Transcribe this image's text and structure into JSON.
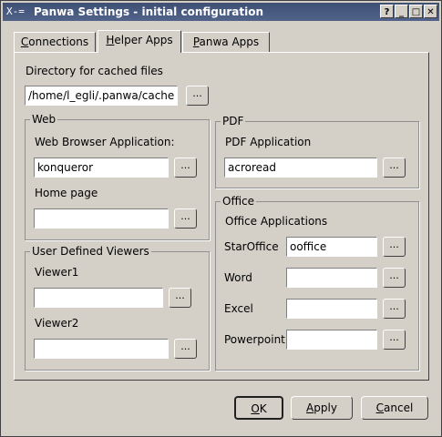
{
  "titlebar": {
    "icon": "X-=",
    "title": "Panwa Settings - initial configuration",
    "buttons": [
      "?",
      "_",
      "□",
      "✕"
    ]
  },
  "tabs": [
    {
      "label": "Connections",
      "accel": "C",
      "rest": "onnections",
      "active": false
    },
    {
      "label": "Helper Apps",
      "accel": "H",
      "rest": "elper Apps",
      "active": true
    },
    {
      "label": "Panwa Apps",
      "accel": "P",
      "rest": "anwa Apps",
      "active": false
    }
  ],
  "cache": {
    "label": "Directory for cached files",
    "value": "/home/l_egli/.panwa/cache",
    "browse": "..."
  },
  "web": {
    "title": "Web",
    "browser_label": "Web Browser Application:",
    "browser_value": "konqueror",
    "homepage_label": "Home page",
    "homepage_value": "",
    "browse": "..."
  },
  "viewers": {
    "title": "User Defined Viewers",
    "viewer1_label": "Viewer1",
    "viewer1_value": "",
    "viewer2_label": "Viewer2",
    "viewer2_value": "",
    "browse": "..."
  },
  "pdf": {
    "title": "PDF",
    "app_label": "PDF Application",
    "app_value": "acroread",
    "browse": "..."
  },
  "office": {
    "title": "Office",
    "apps_label": "Office Applications",
    "rows": [
      {
        "label": "StarOffice",
        "value": "ooffice"
      },
      {
        "label": "Word",
        "value": ""
      },
      {
        "label": "Excel",
        "value": ""
      },
      {
        "label": "Powerpoint",
        "value": ""
      }
    ],
    "browse": "..."
  },
  "footer": {
    "ok": {
      "label": "OK",
      "accel": "O",
      "rest": "K"
    },
    "apply": {
      "label": "Apply",
      "accel": "A",
      "rest": "pply"
    },
    "cancel": {
      "label": "Cancel",
      "accel": "C",
      "rest": "ancel"
    }
  }
}
